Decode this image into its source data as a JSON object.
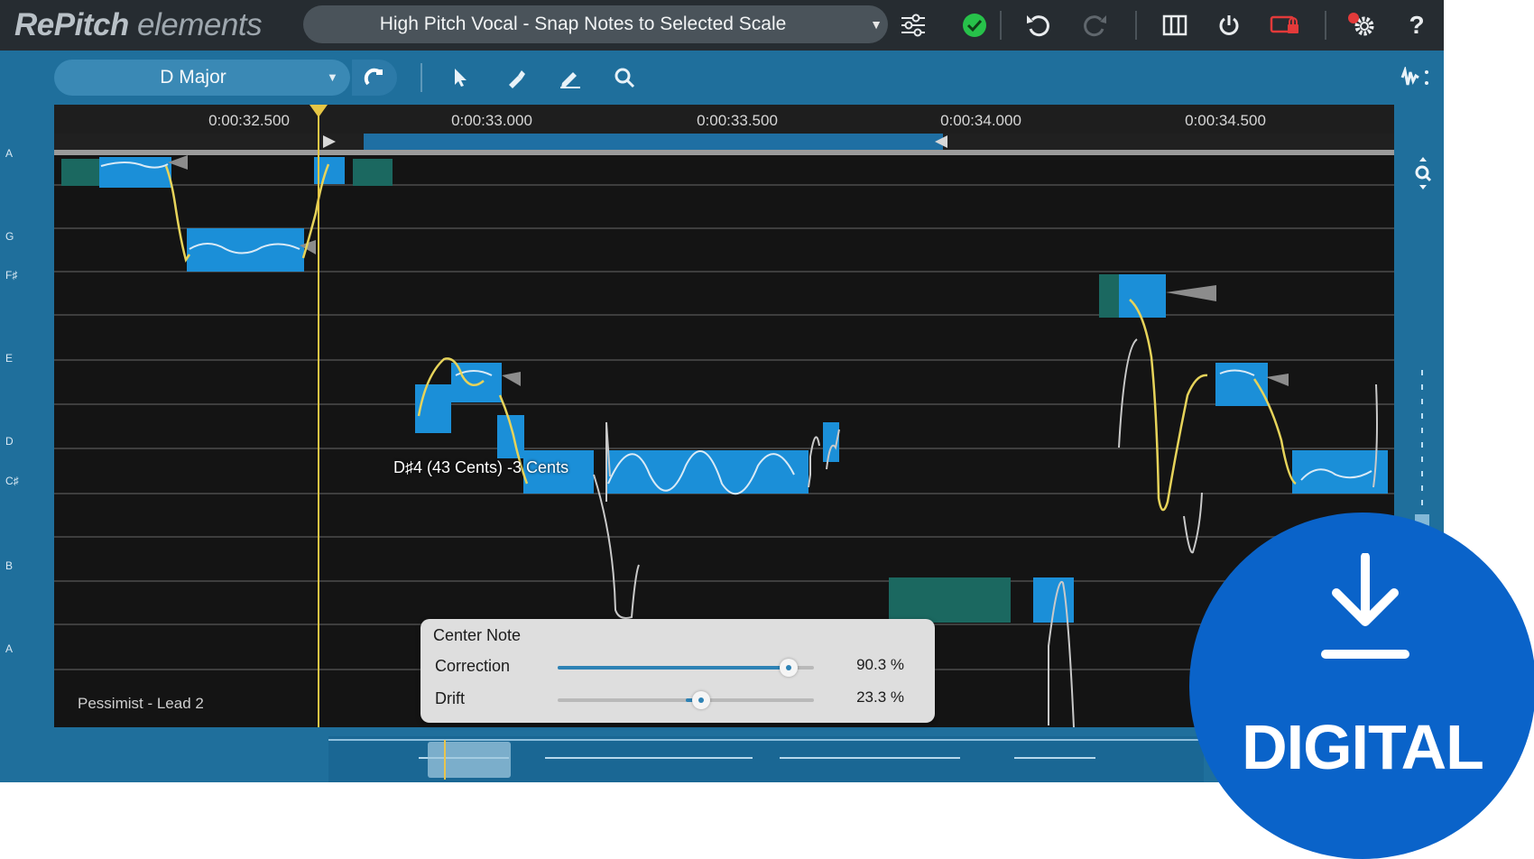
{
  "app": {
    "logo_bold": "RePitch",
    "logo_light": "elements",
    "preset": "High Pitch Vocal - Snap Notes to Selected Scale",
    "scale": "D Major"
  },
  "toolbar": {
    "icons": [
      "settings-sliders-icon",
      "status-ok-icon",
      "undo-icon",
      "redo-icon",
      "piano-roll-icon",
      "power-icon",
      "link-icon",
      "settings-gear-icon",
      "help-icon"
    ],
    "help_label": "?"
  },
  "ruler": {
    "ticks": [
      "0:00:32.500",
      "0:00:33.000",
      "0:00:33.500",
      "0:00:34.000",
      "0:00:34.500"
    ]
  },
  "note_lanes": [
    "A",
    "G",
    "F♯",
    "E",
    "D",
    "C♯",
    "B",
    "A"
  ],
  "pitch_readout": "D♯4 (43 Cents) -3 Cents",
  "track_name": "Pessimist - Lead 2",
  "panel": {
    "title": "Center Note",
    "correction_label": "Correction",
    "correction_value": "90.3 %",
    "correction_level": 0.903,
    "drift_label": "Drift",
    "drift_value": "23.3 %",
    "drift_level": 0.233
  },
  "badge": {
    "text": "DIGITAL"
  },
  "colors": {
    "app_bg": "#1f6f9c",
    "note_blue": "#1b8fd8",
    "note_teal": "#1a5e5a",
    "pitch_yellow": "#e6d35a",
    "badge_blue": "#0a63c9"
  }
}
